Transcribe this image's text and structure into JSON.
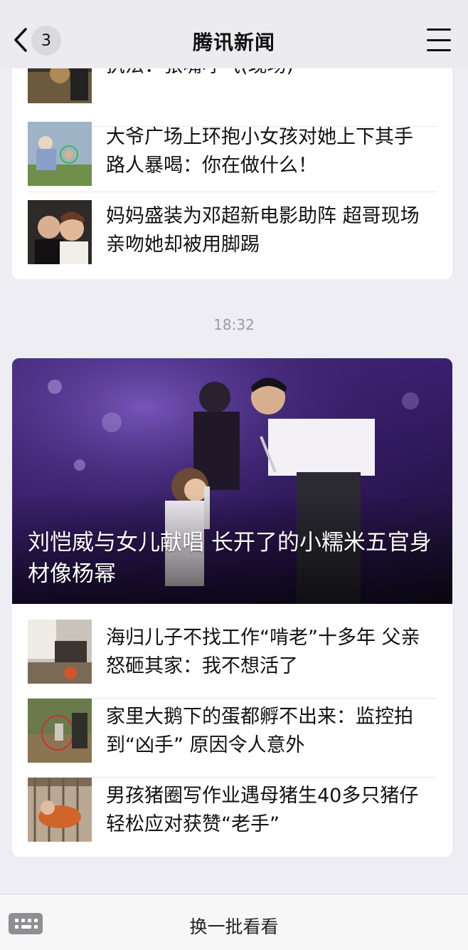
{
  "header": {
    "back_count": "3",
    "title": "腾讯新闻"
  },
  "card1": {
    "items": [
      {
        "title": "执法：张嘴呼气(现场)"
      },
      {
        "title": "大爷广场上环抱小女孩对她上下其手 路人暴喝：你在做什么！"
      },
      {
        "title": "妈妈盛装为邓超新电影助阵 超哥现场亲吻她却被用脚踢"
      }
    ]
  },
  "timestamp": "18:32",
  "card2": {
    "hero_title": "刘恺威与女儿献唱 长开了的小糯米五官身材像杨幂",
    "items": [
      {
        "title": "海归儿子不找工作“啃老”十多年 父亲怒砸其家：我不想活了"
      },
      {
        "title": "家里大鹅下的蛋都孵不出来：监控拍到“凶手” 原因令人意外"
      },
      {
        "title": "男孩猪圈写作业遇母猪生40多只猪仔 轻松应对获赞“老手”"
      }
    ]
  },
  "bottom": {
    "refresh_label": "换一批看看"
  },
  "colors": {
    "background": "#ededf3",
    "header": "#ebebf0",
    "card": "#ffffff",
    "timestamp": "#9a9aa2"
  }
}
